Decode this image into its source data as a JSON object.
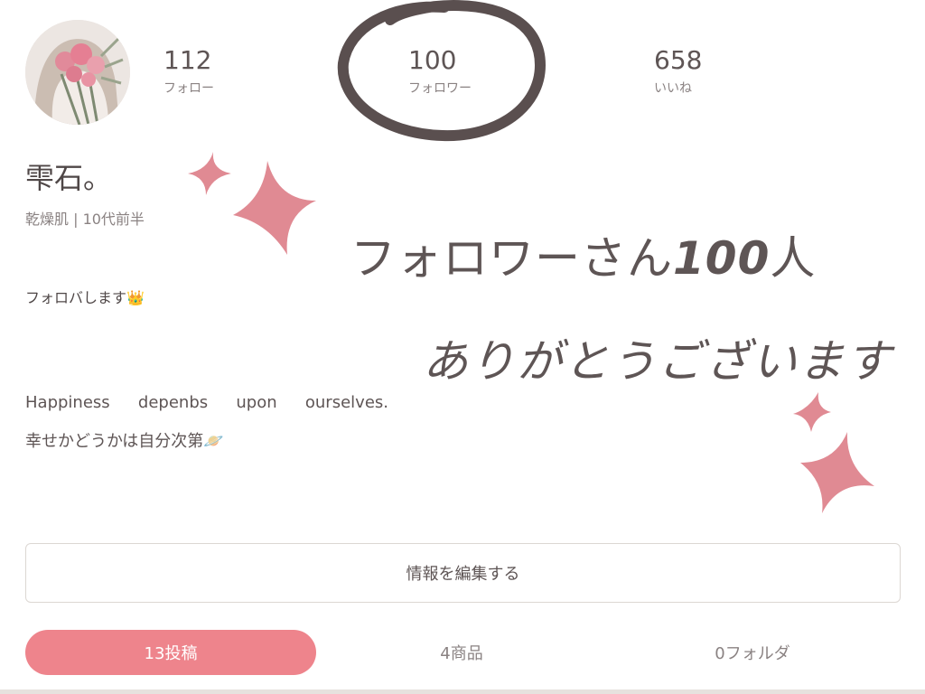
{
  "profile": {
    "name": "雫石。",
    "meta": "乾燥肌 | 10代前半",
    "bio_line1": "フォロバします",
    "bio_line1_emoji": "👑",
    "bio_line2_words": [
      "Happiness",
      "depenbs",
      "upon",
      "ourselves."
    ],
    "bio_line3": "幸せかどうかは自分次第",
    "bio_line3_emoji": "🪐"
  },
  "stats": {
    "following": {
      "count": "112",
      "label": "フォロー"
    },
    "followers": {
      "count": "100",
      "label": "フォロワー"
    },
    "likes": {
      "count": "658",
      "label": "いいね"
    }
  },
  "overlay": {
    "line1_prefix": "フォロワーさん",
    "line1_number": "100",
    "line1_suffix": "人",
    "line2": "ありがとうございます",
    "sparkle_color": "#e08a93",
    "circle_color": "#5a4f4f"
  },
  "actions": {
    "edit_profile": "情報を編集する"
  },
  "tabs": [
    {
      "label": "13投稿",
      "active": true
    },
    {
      "label": "4商品",
      "active": false
    },
    {
      "label": "0フォルダ",
      "active": false
    }
  ],
  "colors": {
    "accent": "#ee848c",
    "text": "#5e5555",
    "muted": "#8a8282"
  }
}
